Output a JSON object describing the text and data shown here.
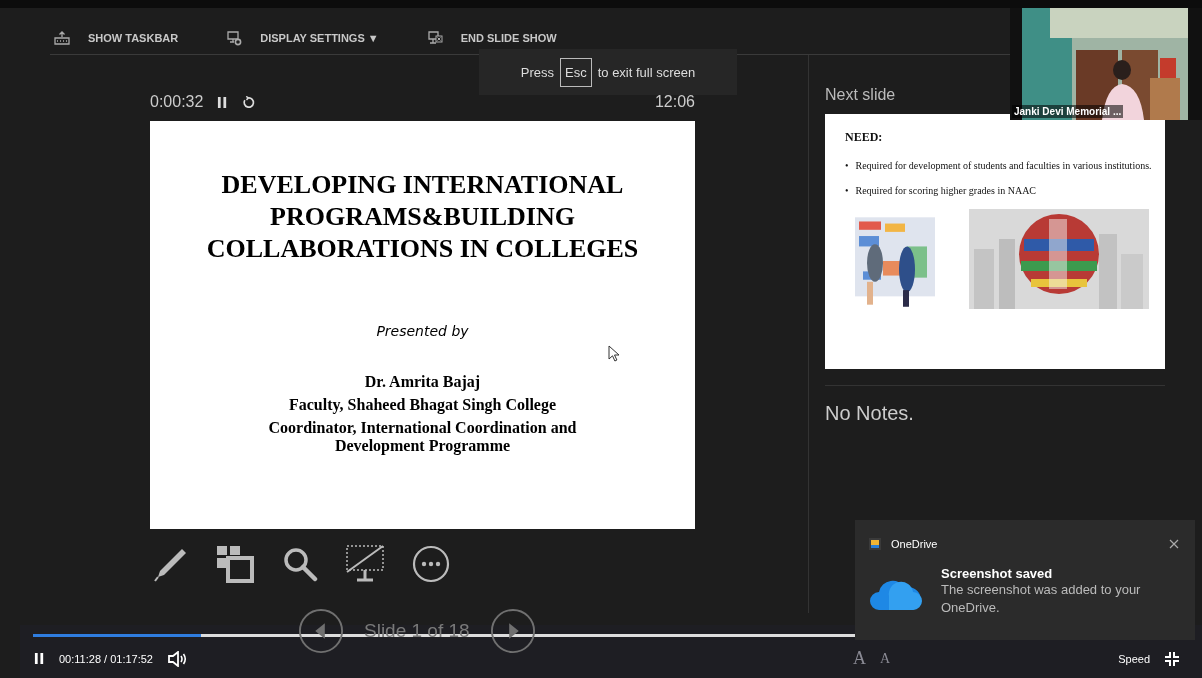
{
  "toolbar": [
    {
      "kind": "taskbar",
      "label": "SHOW TASKBAR"
    },
    {
      "kind": "display",
      "label": "DISPLAY SETTINGS ▼"
    },
    {
      "kind": "end",
      "label": "END SLIDE SHOW"
    }
  ],
  "esc_hint": {
    "before": "Press",
    "key": "Esc",
    "after": "to exit full screen"
  },
  "timer": {
    "elapsed": "0:00:32",
    "clock": "12:06"
  },
  "current_slide": {
    "title_lines": [
      "DEVELOPING INTERNATIONAL",
      "PROGRAMS&BUILDING",
      "COLLABORATIONS IN COLLEGES"
    ],
    "presented_by": "Presented by",
    "author_lines": [
      "Dr. Amrita Bajaj",
      "Faculty, Shaheed Bhagat Singh College",
      "Coordinator, International Coordination and Development Programme"
    ]
  },
  "tools": [
    {
      "kind": "pen"
    },
    {
      "kind": "slides"
    },
    {
      "kind": "zoom"
    },
    {
      "kind": "screen"
    },
    {
      "kind": "more"
    }
  ],
  "next_slide": {
    "label": "Next slide",
    "heading": "NEED:",
    "bullets": [
      {
        "marker": "•",
        "text": "Required for development of students and faculties in various institutions."
      },
      {
        "marker": "•",
        "text": "Required for scoring higher grades in NAAC"
      }
    ]
  },
  "notes": "No Notes.",
  "slide_nav": {
    "label": "Slide 1 of 18"
  },
  "video_tile": {
    "name": "Janki Devi Memorial ..."
  },
  "toast": {
    "app": "OneDrive",
    "title": "Screenshot saved",
    "body": "The screenshot was added to your OneDrive."
  },
  "player": {
    "level": 0.147,
    "time": "00:11:28 / 01:17:52",
    "font_buttons": [
      "A",
      "A"
    ],
    "speed": "Speed"
  }
}
